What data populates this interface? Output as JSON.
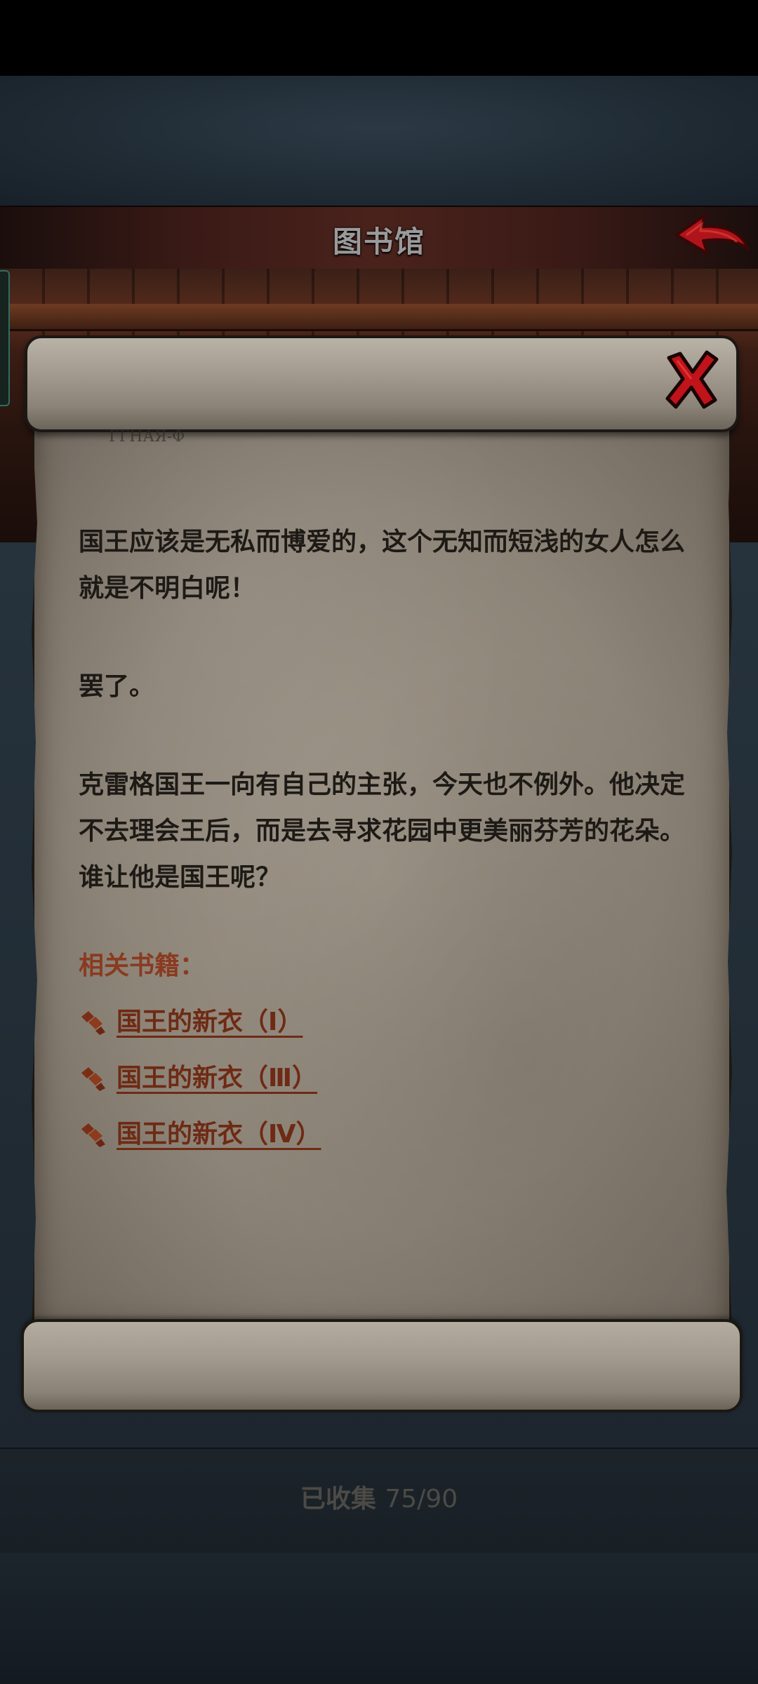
{
  "header": {
    "title": "图书馆",
    "back_label": "back"
  },
  "scroll": {
    "faded_text": "ГГНАЯ-Ф",
    "paragraphs": [
      "国王应该是无私而博爱的，这个无知而短浅的女人怎么就是不明白呢！",
      "罢了。",
      "克雷格国王一向有自己的主张，今天也不例外。他决定不去理会王后，而是去寻求花园中更美丽芬芳的花朵。谁让他是国王呢？"
    ],
    "related_heading": "相关书籍：",
    "related_books": [
      "国王的新衣（Ⅰ）",
      "国王的新衣（Ⅲ）",
      "国王的新衣（Ⅳ）"
    ]
  },
  "footer": {
    "collected_label": "已收集",
    "collected_count": "75/90"
  },
  "colors": {
    "link": "#6e2a14",
    "heading": "#8a3a20",
    "close_x": "#c0131a",
    "back_arrow": "#b0141b"
  },
  "icons": {
    "close": "close-x-icon",
    "back": "back-arrow-icon",
    "book": "book-link-icon"
  }
}
